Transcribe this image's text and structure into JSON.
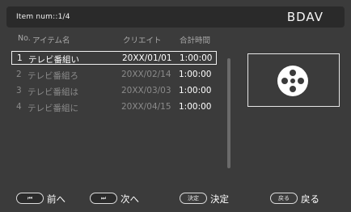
{
  "header": {
    "item_num": "Item num::1/4",
    "mode": "BDAV"
  },
  "columns": {
    "no": "No.",
    "title": "アイテム名",
    "created": "クリエイト",
    "duration": "合計時間"
  },
  "rows": [
    {
      "no": "1",
      "title": "テレビ番組い",
      "date": "20XX/01/01",
      "duration": "1:00:00",
      "selected": true
    },
    {
      "no": "2",
      "title": "テレビ番組ろ",
      "date": "20XX/02/14",
      "duration": "1:00:00",
      "selected": false
    },
    {
      "no": "3",
      "title": "テレビ番組は",
      "date": "20XX/03/03",
      "duration": "1:00:00",
      "selected": false
    },
    {
      "no": "4",
      "title": "テレビ番組に",
      "date": "20XX/04/15",
      "duration": "1:00:00",
      "selected": false
    }
  ],
  "preview": {
    "icon": "film-reel-icon"
  },
  "footer": {
    "prev": {
      "key": "⏮",
      "label": "前へ"
    },
    "next": {
      "key": "⏭",
      "label": "次へ"
    },
    "enter": {
      "key": "決定",
      "label": "決定"
    },
    "back": {
      "key": "戻る",
      "label": "戻る"
    }
  },
  "colors": {
    "background": "#3b3b3b",
    "header": "#2a2a2a",
    "dim_text": "#8a8a8a",
    "header_text": "#a9a9a9"
  }
}
